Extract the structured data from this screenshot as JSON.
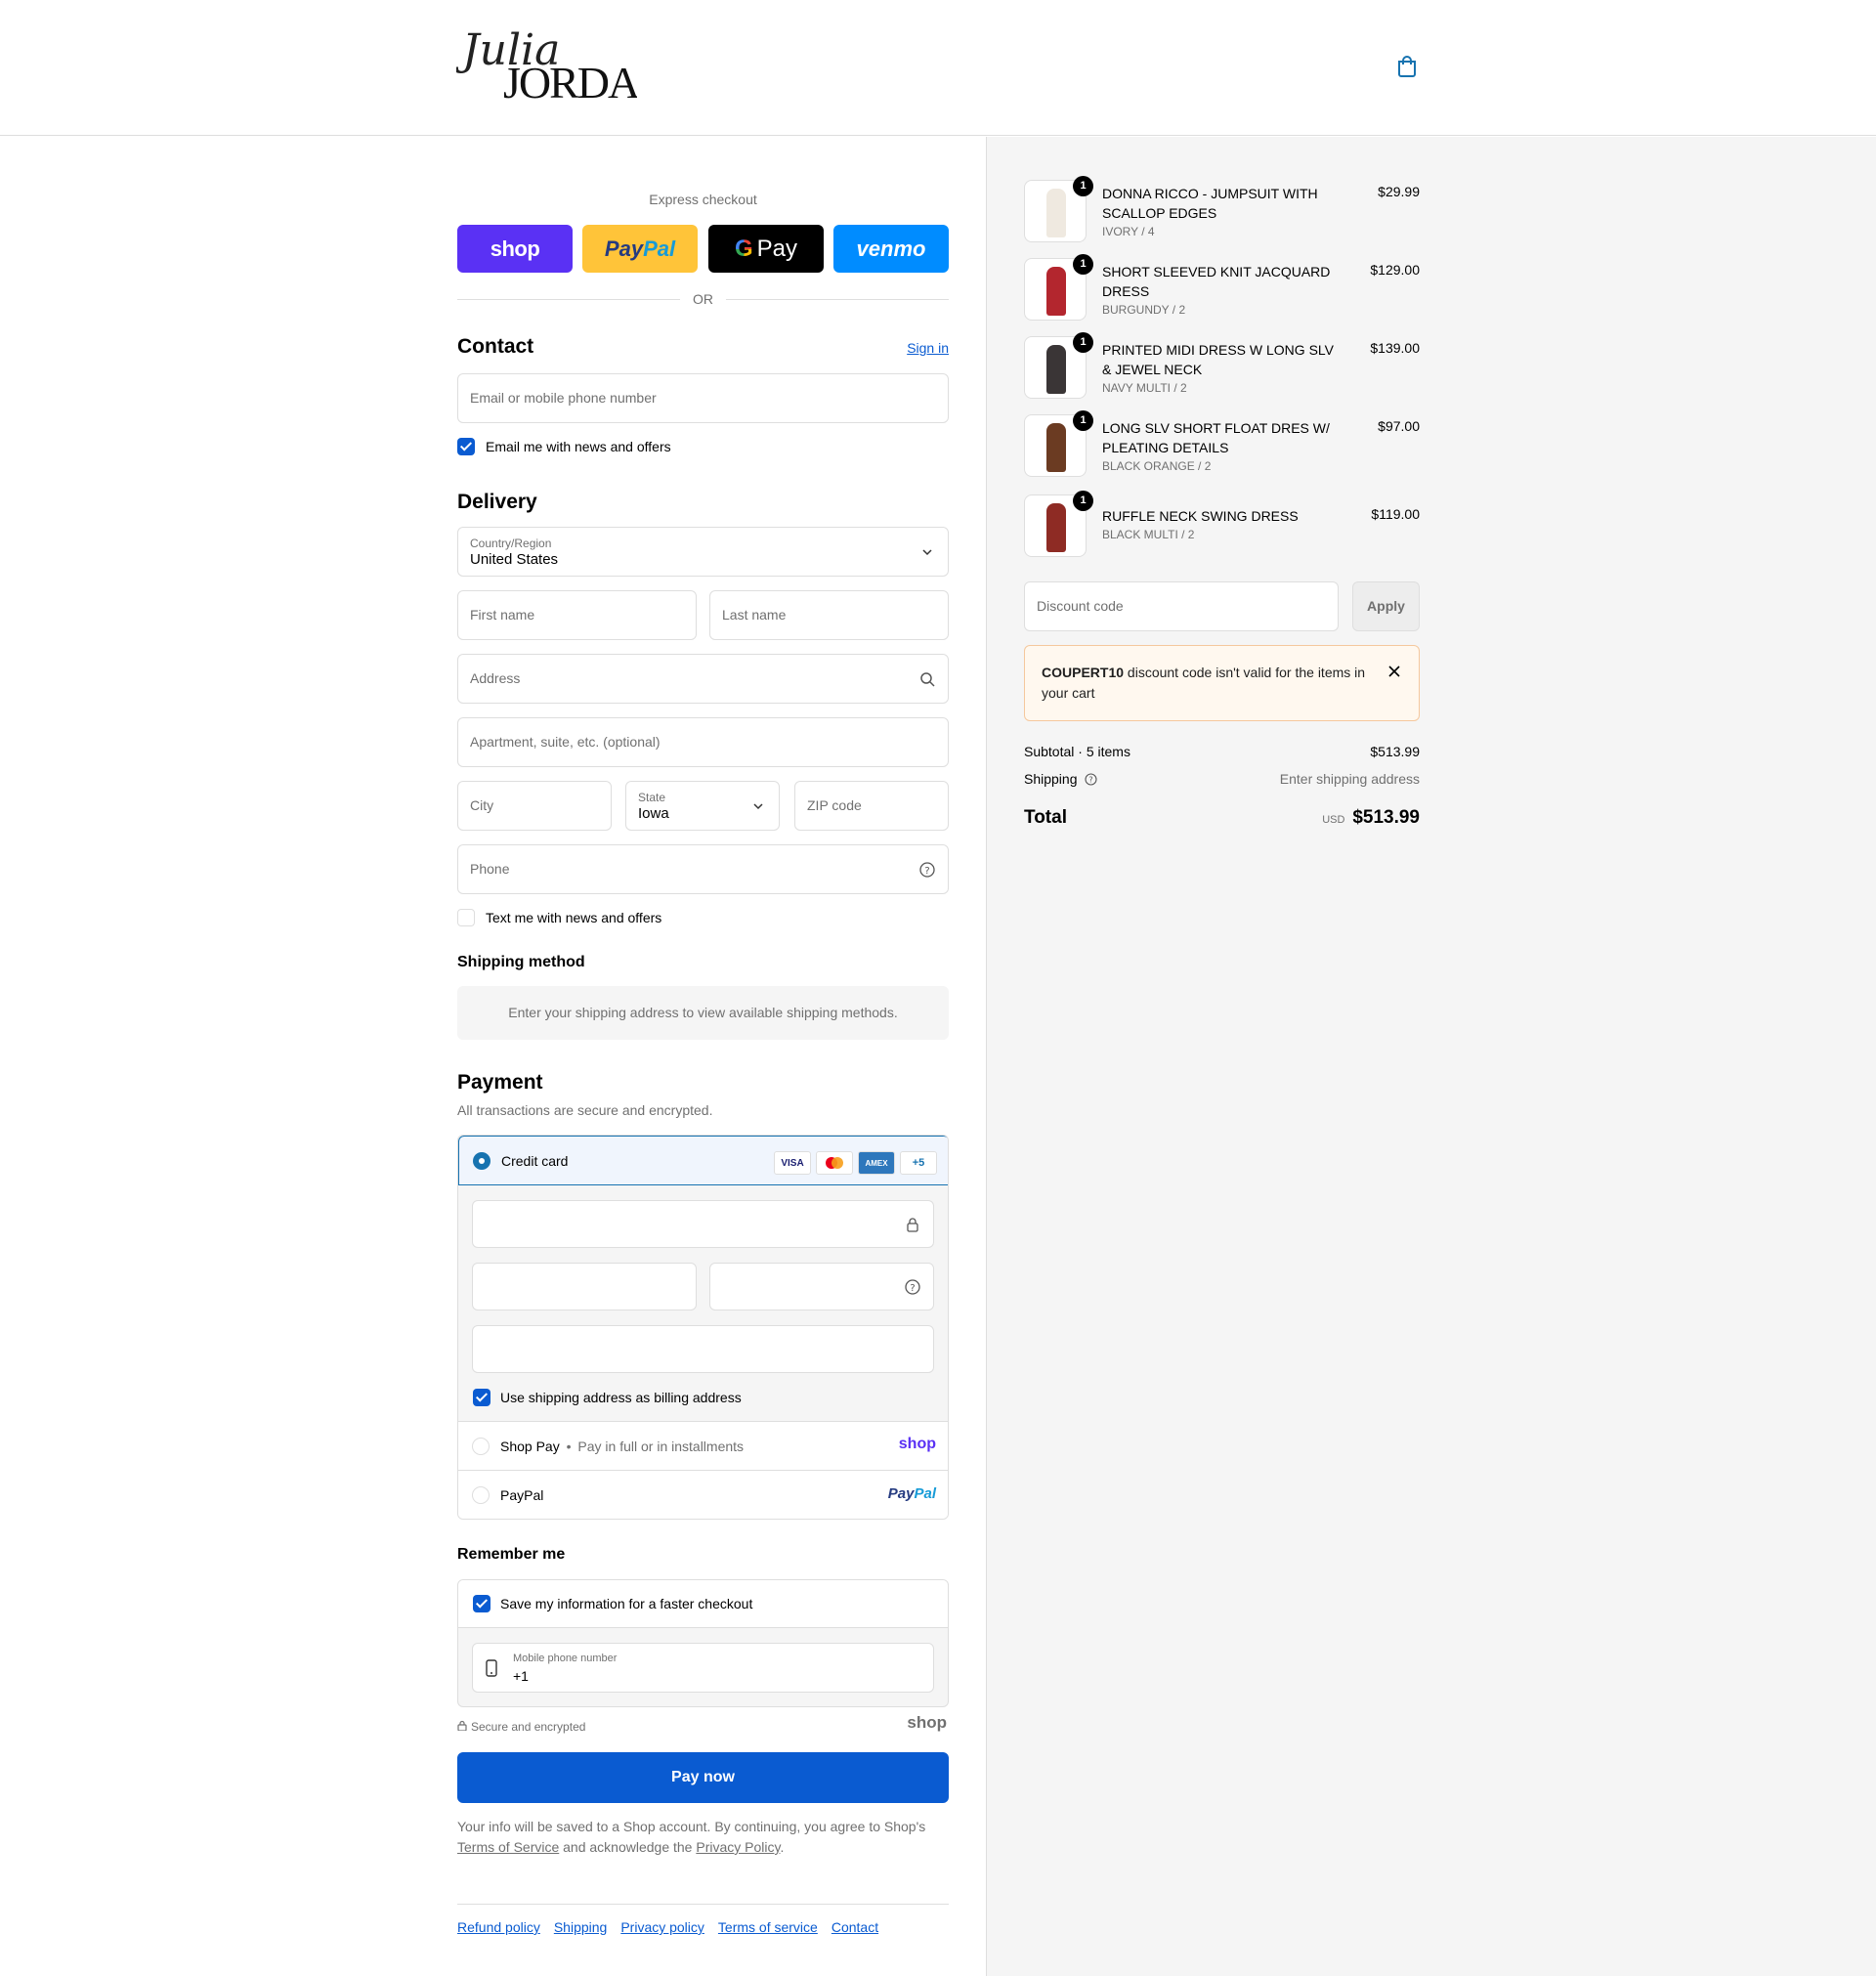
{
  "brand": {
    "logo_script": "Julia",
    "logo_name": "JORDAN"
  },
  "express": {
    "title": "Express checkout",
    "shop_label": "shop",
    "paypal_label_1": "Pay",
    "paypal_label_2": "Pal",
    "gpay_label": "Pay",
    "venmo_label": "venmo",
    "or_label": "OR"
  },
  "contact": {
    "heading": "Contact",
    "signin": "Sign in",
    "email_placeholder": "Email or mobile phone number",
    "news_label": "Email me with news and offers",
    "news_checked": true
  },
  "delivery": {
    "heading": "Delivery",
    "country_label": "Country/Region",
    "country_value": "United States",
    "first_name": "First name",
    "last_name": "Last name",
    "address": "Address",
    "apartment": "Apartment, suite, etc. (optional)",
    "city": "City",
    "state_label": "State",
    "state_value": "Iowa",
    "zip": "ZIP code",
    "phone": "Phone",
    "text_label": "Text me with news and offers"
  },
  "shipping_method": {
    "heading": "Shipping method",
    "message": "Enter your shipping address to view available shipping methods."
  },
  "payment": {
    "heading": "Payment",
    "subheading": "All transactions are secure and encrypted.",
    "credit_card": "Credit card",
    "visa": "VISA",
    "amex": "AMEX",
    "more": "+5",
    "billing_label": "Use shipping address as billing address",
    "shop_pay": "Shop Pay",
    "shop_pay_sep": "•",
    "shop_pay_desc": "Pay in full or in installments",
    "shop_pay_logo": "shop",
    "paypal": "PayPal",
    "paypal_logo_1": "Pay",
    "paypal_logo_2": "Pal"
  },
  "remember": {
    "heading": "Remember me",
    "save_label": "Save my information for a faster checkout",
    "mobile_label": "Mobile phone number",
    "mobile_value": "+1",
    "secure": "Secure and encrypted",
    "shop_logo": "shop"
  },
  "pay_now": "Pay now",
  "legal": {
    "text_1": "Your info will be saved to a Shop account. By continuing, you agree to Shop's",
    "terms": "Terms of Service",
    "text_2": "and acknowledge the",
    "privacy": "Privacy Policy",
    "text_3": "."
  },
  "footer": [
    "Refund policy",
    "Shipping",
    "Privacy policy",
    "Terms of service",
    "Contact"
  ],
  "cart": {
    "items": [
      {
        "qty": "1",
        "name": "DONNA RICCO - JUMPSUIT WITH SCALLOP EDGES",
        "variant": "IVORY / 4",
        "price": "$29.99",
        "color": "#efe9e0"
      },
      {
        "qty": "1",
        "name": "SHORT SLEEVED KNIT JACQUARD DRESS",
        "variant": "BURGUNDY / 2",
        "price": "$129.00",
        "color": "#b3262e"
      },
      {
        "qty": "1",
        "name": "PRINTED MIDI DRESS W LONG SLV & JEWEL NECK",
        "variant": "NAVY MULTI / 2",
        "price": "$139.00",
        "color": "#3a3536"
      },
      {
        "qty": "1",
        "name": "LONG SLV SHORT FLOAT DRES W/ PLEATING DETAILS",
        "variant": "BLACK ORANGE / 2",
        "price": "$97.00",
        "color": "#6b3b22"
      },
      {
        "qty": "1",
        "name": "RUFFLE NECK SWING DRESS",
        "variant": "BLACK MULTI / 2",
        "price": "$119.00",
        "color": "#8e2b24"
      }
    ],
    "discount_placeholder": "Discount code",
    "apply": "Apply",
    "alert_code": "COUPERT10",
    "alert_msg": "discount code isn't valid for the items in your cart",
    "subtotal_label": "Subtotal · 5 items",
    "subtotal_value": "$513.99",
    "shipping_label": "Shipping",
    "shipping_value": "Enter shipping address",
    "total_label": "Total",
    "currency": "USD",
    "total_value": "$513.99"
  },
  "colors": {
    "accent": "#0a5bd1",
    "shop_purple": "#5a31f4",
    "paypal_yellow": "#ffc439",
    "venmo_blue": "#008cff"
  }
}
